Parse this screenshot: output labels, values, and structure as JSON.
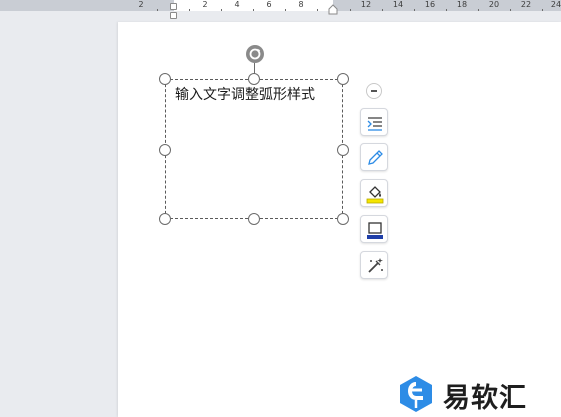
{
  "ruler": {
    "left_labels": [
      "2"
    ],
    "right_labels": [
      "2",
      "4",
      "6",
      "8"
    ],
    "far_labels": [
      "12",
      "14",
      "16",
      "18",
      "20",
      "22",
      "24"
    ]
  },
  "textbox": {
    "content": "输入文字调整弧形样式"
  },
  "toolbar": {
    "collapse": "collapse",
    "tools": [
      {
        "name": "wrap-text",
        "icon": "wrap-text-icon"
      },
      {
        "name": "outline-style",
        "icon": "pen-icon"
      },
      {
        "name": "fill",
        "icon": "fill-bucket-icon"
      },
      {
        "name": "border",
        "icon": "border-box-icon"
      },
      {
        "name": "effects",
        "icon": "magic-wand-icon"
      }
    ]
  },
  "watermark": {
    "text": "易软汇"
  },
  "colors": {
    "accent": "#2d8ce6",
    "fill_yellow": "#f5e500",
    "border_blue": "#1f3ea8"
  }
}
